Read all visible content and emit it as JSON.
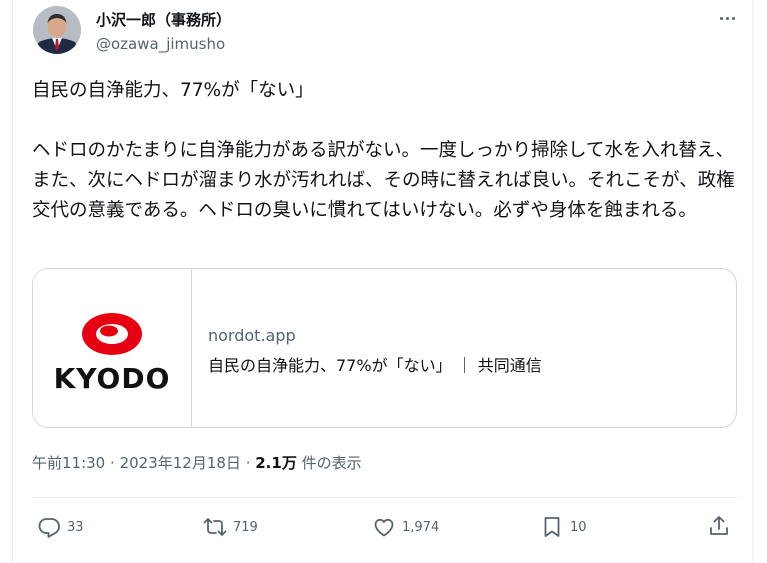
{
  "author": {
    "display_name": "小沢一郎（事務所）",
    "handle": "@ozawa_jimusho"
  },
  "tweet": {
    "text": "自民の自浄能力、77%が「ない」\n\nヘドロのかたまりに自浄能力がある訳がない。一度しっかり掃除して水を入れ替え、また、次にヘドロが溜まり水が汚れれば、その時に替えれば良い。それこそが、政権交代の意義である。ヘドロの臭いに慣れてはいけない。必ずや身体を蝕まれる。"
  },
  "link_card": {
    "logo_text": "KYODO",
    "domain": "nordot.app",
    "title": "自民の自浄能力、77%が「ない」 ｜ 共同通信"
  },
  "meta": {
    "time": "午前11:30",
    "date": "2023年12月18日",
    "views_count": "2.1万",
    "views_label": "件の表示"
  },
  "actions": {
    "replies": "33",
    "retweets": "719",
    "likes": "1,974",
    "bookmarks": "10"
  },
  "colors": {
    "kyodo_red": "#e60012",
    "secondary_text": "#536471",
    "border": "#cfd9de"
  },
  "icons": [
    "more-icon",
    "reply-icon",
    "retweet-icon",
    "like-icon",
    "bookmark-icon",
    "share-icon"
  ]
}
